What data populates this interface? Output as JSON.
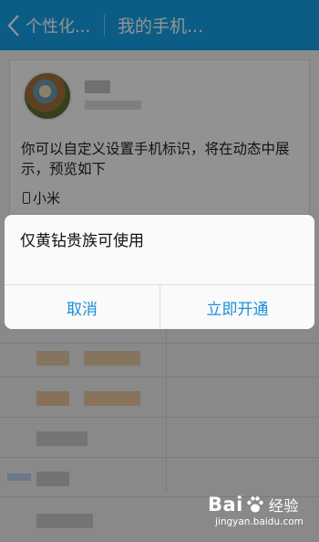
{
  "header": {
    "back_label": "个性化...",
    "title": "我的手机..."
  },
  "card": {
    "description": "你可以自定义设置手机标识，将在动态中展示，预览如下",
    "device_label": "小米"
  },
  "dialog": {
    "message": "仅黄钻贵族可使用",
    "cancel_label": "取消",
    "confirm_label": "立即开通"
  },
  "watermark": {
    "brand": "Bai",
    "brand_suffix": "经验",
    "url": "jingyan.baidu.com"
  },
  "colors": {
    "titlebar": "#13a0e6",
    "dialog_button": "#1a8fd8"
  }
}
